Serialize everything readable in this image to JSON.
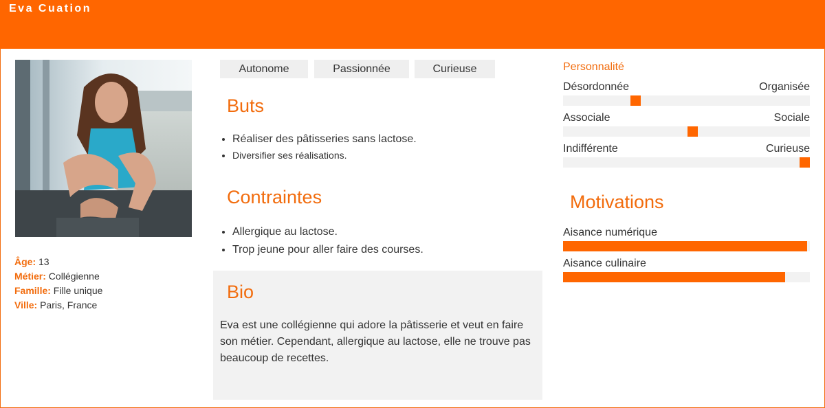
{
  "header": {
    "title": "Eva Cuation"
  },
  "profile": {
    "age_label": "Âge:",
    "age": "13",
    "job_label": "Métier:",
    "job": "Collégienne",
    "family_label": "Famille:",
    "family": "Fille unique",
    "city_label": "Ville:",
    "city": "Paris, France"
  },
  "tags": [
    "Autonome",
    "Passionnée",
    "Curieuse"
  ],
  "goals": {
    "title": "Buts",
    "items": [
      "Réaliser des pâtisseries sans lactose.",
      "Diversifier ses réalisations."
    ]
  },
  "constraints": {
    "title": "Contraintes",
    "items": [
      "Allergique au lactose.",
      "Trop jeune pour aller faire des courses."
    ]
  },
  "bio": {
    "title": "Bio",
    "text": "Eva est une collégienne qui adore la pâtisserie et veut en faire son métier. Cependant, allergique au lactose, elle ne trouve pas beaucoup de recettes."
  },
  "personality": {
    "title": "Personnalité",
    "traits": [
      {
        "left": "Désordonnée",
        "right": "Organisée",
        "value": 0.285
      },
      {
        "left": "Associale",
        "right": "Sociale",
        "value": 0.525
      },
      {
        "left": "Indifférente",
        "right": "Curieuse",
        "value": 1.0
      }
    ]
  },
  "motivations": {
    "title": "Motivations",
    "items": [
      {
        "label": "Aisance numérique",
        "value": 0.99
      },
      {
        "label": "Aisance culinaire",
        "value": 0.9
      }
    ]
  },
  "colors": {
    "accent": "#ff6600",
    "accent_text": "#f26c0d",
    "track": "#f2f2f2"
  },
  "icons": {
    "photo": "portrait-photo"
  }
}
